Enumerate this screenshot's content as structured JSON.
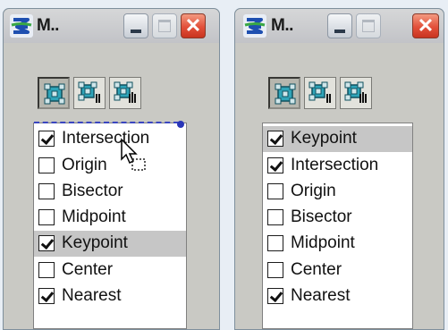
{
  "panels": [
    {
      "title": "M..",
      "titlebar_buttons": [
        "minimize-icon",
        "maximize-icon",
        "close-icon"
      ],
      "close_glyph": "✕",
      "tools": [
        "snap-tool-icon",
        "snap-tool-multi-icon",
        "snap-tool-table-icon"
      ],
      "items": [
        {
          "label": "Intersection",
          "checked": true,
          "selected": false
        },
        {
          "label": "Origin",
          "checked": false,
          "selected": false
        },
        {
          "label": "Bisector",
          "checked": false,
          "selected": false
        },
        {
          "label": "Midpoint",
          "checked": false,
          "selected": false
        },
        {
          "label": "Keypoint",
          "checked": true,
          "selected": true
        },
        {
          "label": "Center",
          "checked": false,
          "selected": false
        },
        {
          "label": "Nearest",
          "checked": true,
          "selected": false
        }
      ]
    },
    {
      "title": "M..",
      "titlebar_buttons": [
        "minimize-icon",
        "maximize-icon",
        "close-icon"
      ],
      "close_glyph": "✕",
      "tools": [
        "snap-tool-icon",
        "snap-tool-multi-icon",
        "snap-tool-table-icon"
      ],
      "items": [
        {
          "label": "Keypoint",
          "checked": true,
          "selected": true
        },
        {
          "label": "Intersection",
          "checked": true,
          "selected": false
        },
        {
          "label": "Origin",
          "checked": false,
          "selected": false
        },
        {
          "label": "Bisector",
          "checked": false,
          "selected": false
        },
        {
          "label": "Midpoint",
          "checked": false,
          "selected": false
        },
        {
          "label": "Center",
          "checked": false,
          "selected": false
        },
        {
          "label": "Nearest",
          "checked": true,
          "selected": false
        }
      ]
    }
  ],
  "colors": {
    "window_bg": "#c9c9c4",
    "selected_row": "#c6c6c6",
    "close_button": "#e2503a",
    "drag_outline": "#3a46c0"
  }
}
